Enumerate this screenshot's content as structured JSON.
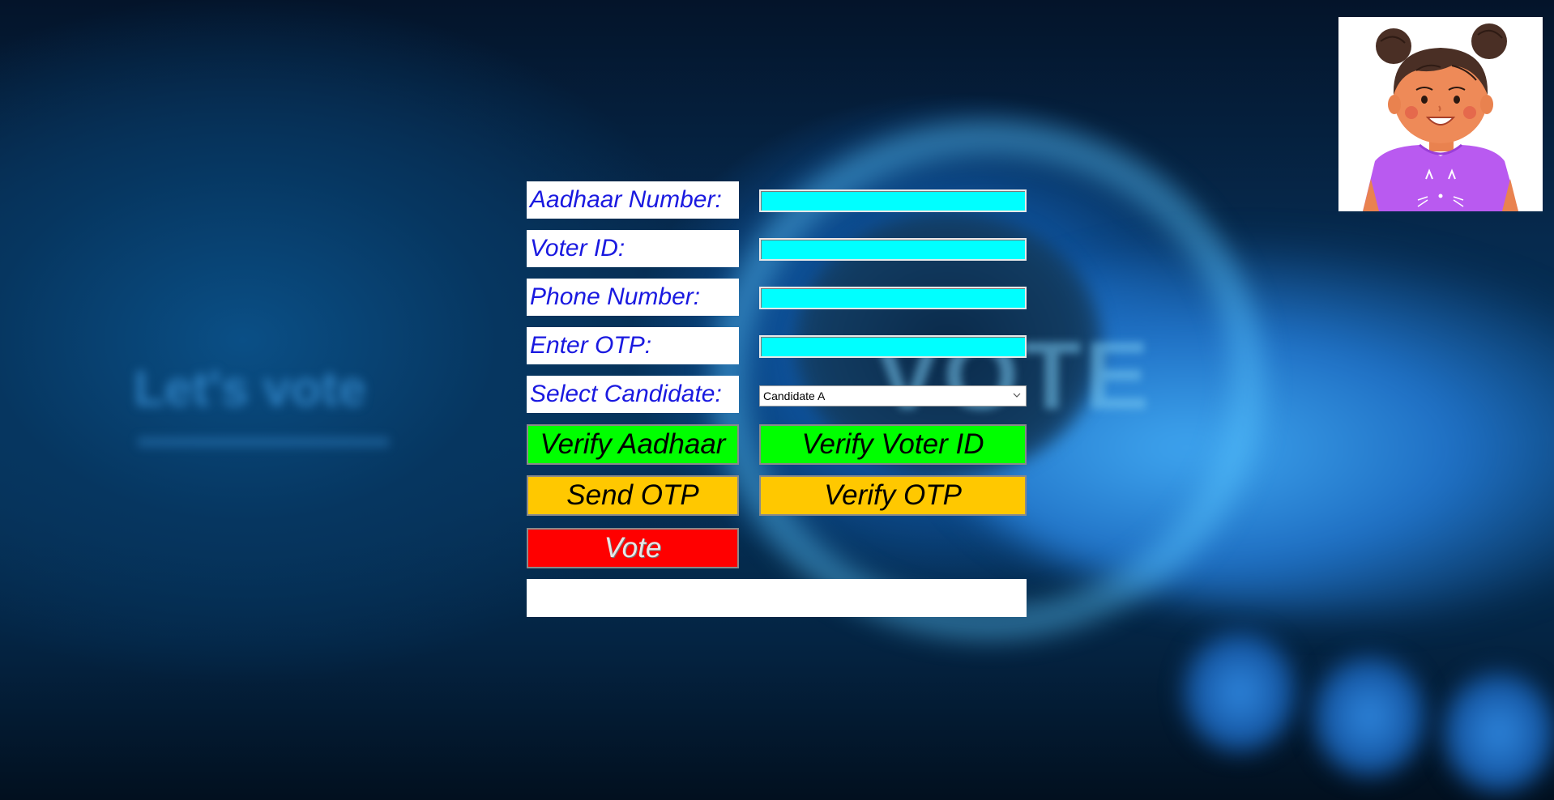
{
  "background": {
    "headline": "Let's vote",
    "watermark": "VOTE"
  },
  "form": {
    "aadhaar_label": "Aadhaar Number:",
    "voter_id_label": "Voter ID:",
    "phone_label": "Phone Number:",
    "otp_label": "Enter OTP:",
    "candidate_label": "Select Candidate:",
    "aadhaar_value": "",
    "voter_id_value": "",
    "phone_value": "",
    "otp_value": "",
    "candidate_selected": "Candidate A"
  },
  "buttons": {
    "verify_aadhaar": "Verify Aadhaar",
    "verify_voter_id": "Verify Voter ID",
    "send_otp": "Send OTP",
    "verify_otp": "Verify OTP",
    "vote": "Vote"
  },
  "status": {
    "message": ""
  },
  "avatar": {
    "icon": "girl-avatar-icon"
  },
  "colors": {
    "label_text": "#1a19e0",
    "input_bg": "#00ffff",
    "verify_green": "#00ff00",
    "otp_amber": "#ffc800",
    "vote_red": "#ff0000"
  }
}
